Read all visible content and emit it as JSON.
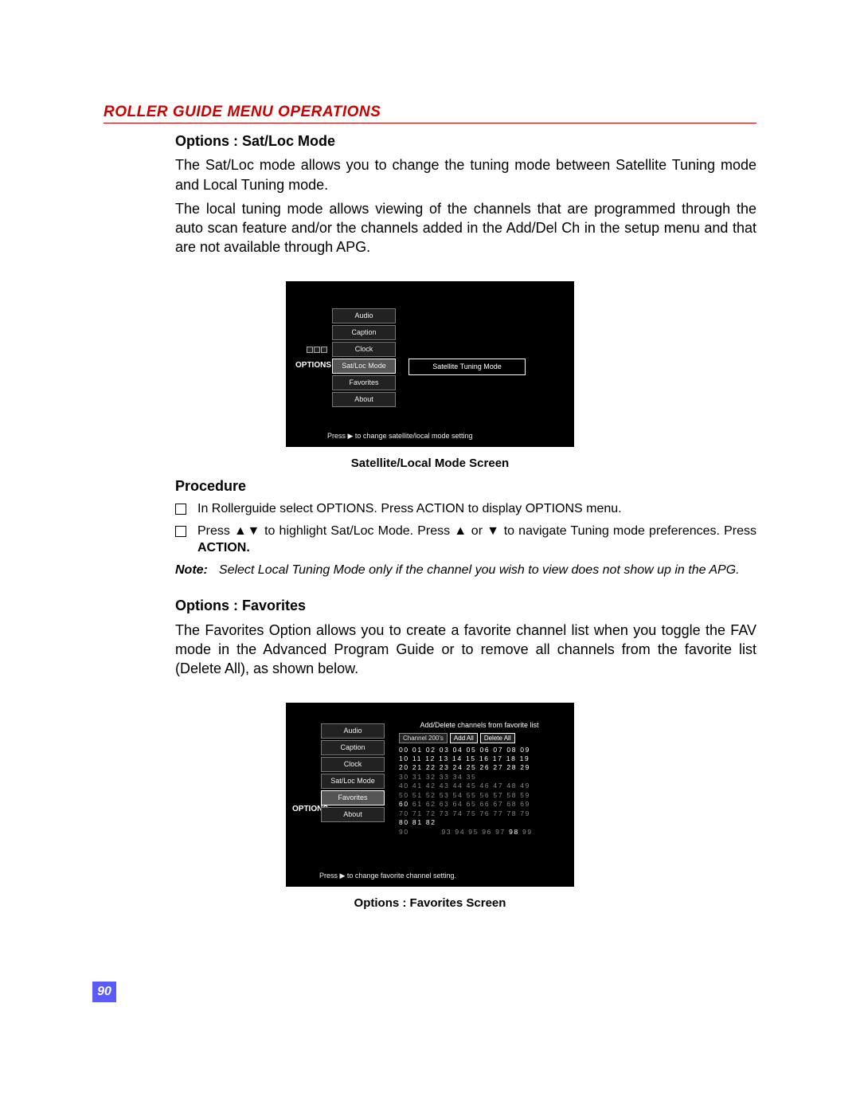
{
  "header": "ROLLER GUIDE MENU OPERATIONS",
  "section1": {
    "title": "Options : Sat/Loc Mode",
    "para1": "The Sat/Loc mode allows you to change the tuning mode between Satellite Tuning mode and Local Tuning mode.",
    "para2": "The local tuning mode allows viewing of the channels that are programmed through the auto scan feature and/or the channels added in the Add/Del Ch in the setup menu and that are not available through APG."
  },
  "figure1": {
    "options_label": "OPTIONS",
    "menu": [
      "Audio",
      "Caption",
      "Clock",
      "Sat/Loc Mode",
      "Favorites",
      "About"
    ],
    "selected_index": 3,
    "value": "Satellite Tuning Mode",
    "hint": "Press ▶ to change satellite/local mode setting",
    "caption": "Satellite/Local Mode Screen"
  },
  "procedure": {
    "heading": "Procedure",
    "step1": "In Rollerguide select OPTIONS. Press ACTION to display OPTIONS menu.",
    "step2_a": "Press ▲▼ to highlight Sat/Loc Mode. Press ▲ or ▼ to navigate Tuning mode preferences. Press ",
    "step2_b": "ACTION.",
    "note_label": "Note:",
    "note_text": "Select Local Tuning Mode only if the channel you wish to view does not show up in the APG."
  },
  "section2": {
    "title": "Options : Favorites",
    "para": "The Favorites Option allows you to create a favorite channel list when you toggle the FAV mode in the Advanced Program Guide or to remove all channels from the favorite list (Delete All), as shown below."
  },
  "figure2": {
    "options_label": "OPTIONS",
    "menu": [
      "Audio",
      "Caption",
      "Clock",
      "Sat/Loc Mode",
      "Favorites",
      "About"
    ],
    "selected_index": 4,
    "right_title": "Add/Delete channels from favorite list",
    "buttons": [
      "Channel 200's",
      "Add All",
      "Delete All"
    ],
    "hint": "Press ▶ to change favorite channel setting.",
    "caption": "Options : Favorites Screen",
    "rows": [
      {
        "pre": "",
        "lit": "00 01 02 03 04 05 06 07 08 09",
        "post": ""
      },
      {
        "pre": "",
        "lit": "10 11 12 13 14 15 16 17 18 19",
        "post": ""
      },
      {
        "pre": "",
        "lit": "20 21 22 23 24 25 26 27 28 29",
        "post": ""
      },
      {
        "pre": "30 31 32 33 34 35",
        "lit": "",
        "post": ""
      },
      {
        "pre": "40 41 42 43 44 45 46 47 48 49",
        "lit": "",
        "post": ""
      },
      {
        "pre": "50 51 52 53 54 55 56 57 58 59",
        "lit": "",
        "post": ""
      },
      {
        "pre": "",
        "lit": "60",
        "post": " 61 62 63 64 65 66 67 68 69"
      },
      {
        "pre": "70 71 72 73 74 75 76 77 78 79",
        "lit": "",
        "post": ""
      },
      {
        "pre": "",
        "lit": "80 81 82",
        "post": ""
      },
      {
        "pre": "90          93 94 95 96 97 ",
        "lit": "98",
        "post": " 99"
      }
    ]
  },
  "page_number": "90"
}
